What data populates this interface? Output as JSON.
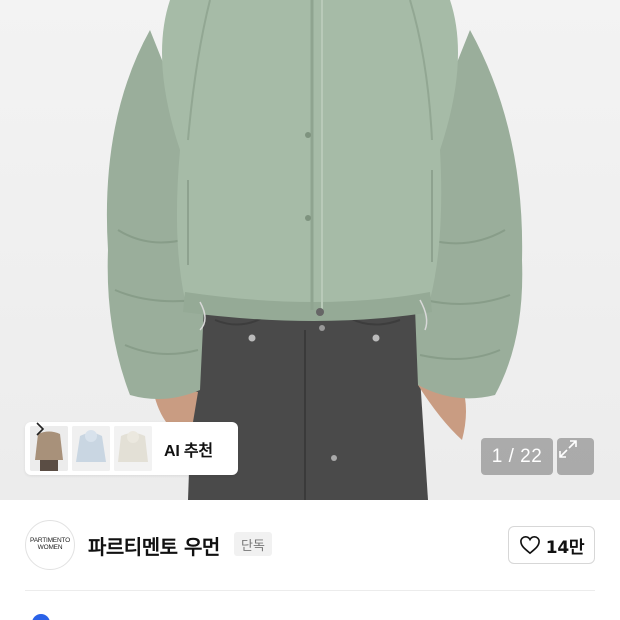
{
  "hero": {
    "ai_recommend_label": "AI 추천",
    "image_counter": "1 / 22"
  },
  "brand": {
    "logo_line1": "PARTIMENTO",
    "logo_line2": "WOMEN",
    "name": "파르티멘토 우먼",
    "badge": "단독"
  },
  "like": {
    "count": "14만"
  },
  "colors": {
    "jacket": "#9db4a0",
    "pants": "#4a4a4a",
    "accent_blue": "#2a62e8"
  }
}
